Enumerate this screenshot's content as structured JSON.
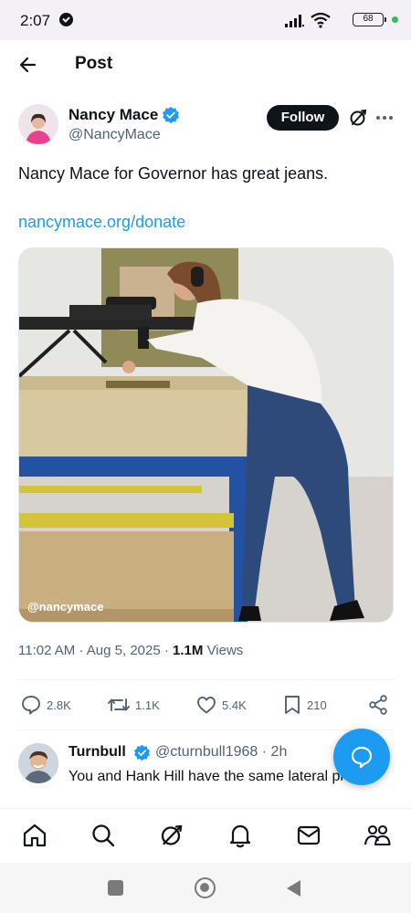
{
  "status_bar": {
    "time": "2:07",
    "battery": "68"
  },
  "header": {
    "title": "Post"
  },
  "post": {
    "author_name": "Nancy Mace",
    "author_handle": "@NancyMace",
    "follow_label": "Follow",
    "text": "Nancy Mace for Governor has great jeans.",
    "link": "nancymace.org/donate",
    "image_watermark": "@nancymace",
    "time": "11:02 AM",
    "date": "Aug 5, 2025",
    "views_count": "1.1M",
    "views_label": "Views",
    "separator": "·"
  },
  "actions": {
    "replies": "2.8K",
    "reposts": "1.1K",
    "likes": "5.4K",
    "bookmarks": "210"
  },
  "reply": {
    "name": "Turnbull",
    "handle": "@cturnbull1968",
    "time": "2h",
    "text": "You and Hank Hill have the same lateral profile."
  },
  "colors": {
    "accent": "#1d9bf0",
    "text_primary": "#0f1419",
    "text_secondary": "#536471",
    "status_bar_bg": "#f3f0f6"
  },
  "icons": [
    "back-arrow-icon",
    "verified-icon",
    "grok-icon",
    "more-icon",
    "reply-icon",
    "repost-icon",
    "like-icon",
    "bookmark-icon",
    "share-icon",
    "compose-reply-icon",
    "home-icon",
    "search-icon",
    "grok-tab-icon",
    "notifications-icon",
    "messages-icon",
    "communities-icon"
  ]
}
